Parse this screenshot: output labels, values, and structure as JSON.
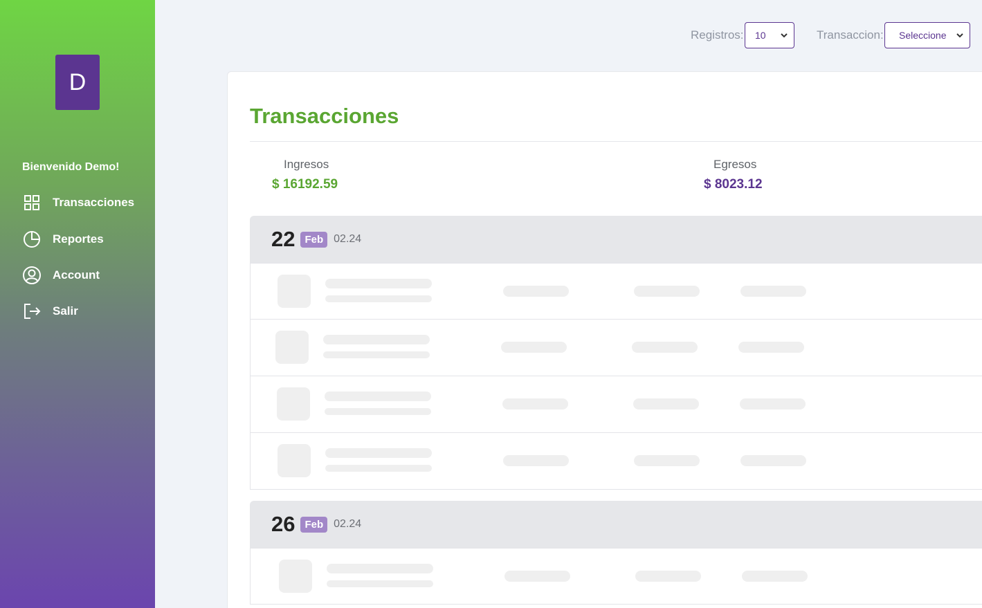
{
  "sidebar": {
    "logo_letter": "D",
    "welcome": "Bienvenido Demo!",
    "items": [
      {
        "label": "Transacciones",
        "icon": "grid-icon"
      },
      {
        "label": "Reportes",
        "icon": "pie-chart-icon"
      },
      {
        "label": "Account",
        "icon": "user-circle-icon"
      },
      {
        "label": "Salir",
        "icon": "logout-icon"
      }
    ]
  },
  "filters": {
    "registros_label": "Registros:",
    "registros_value": "10",
    "transaccion_label": "Transaccion:",
    "transaccion_value": "Seleccione"
  },
  "main": {
    "title": "Transacciones",
    "ingresos_label": "Ingresos",
    "ingresos_value": "$ 16192.59",
    "egresos_label": "Egresos",
    "egresos_value": "$ 8023.12",
    "groups": [
      {
        "day": "22",
        "month": "Feb",
        "year": "02.24"
      },
      {
        "day": "26",
        "month": "Feb",
        "year": "02.24"
      }
    ]
  },
  "colors": {
    "accent_green": "#5aa632",
    "accent_purple": "#5b3590",
    "badge_purple": "#a287c8"
  }
}
